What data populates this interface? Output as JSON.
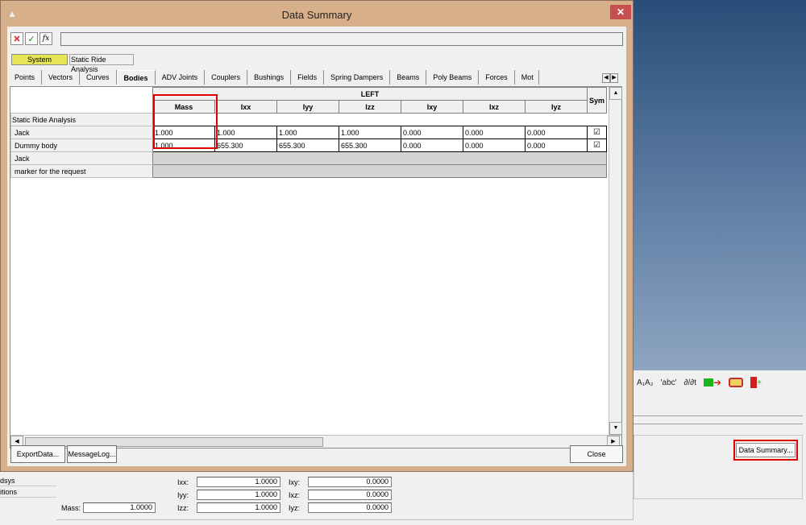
{
  "dialog": {
    "title": "Data Summary",
    "close_glyph": "✕",
    "app_icon": "app-triangle-icon"
  },
  "formula_bar": {
    "cancel_glyph": "✕",
    "accept_glyph": "✓",
    "fx_glyph": "fx",
    "value": ""
  },
  "system": {
    "button_label": "System",
    "current": "Static Ride Analysis"
  },
  "tabs": [
    {
      "label": "Points"
    },
    {
      "label": "Vectors"
    },
    {
      "label": "Curves"
    },
    {
      "label": "Bodies",
      "active": true
    },
    {
      "label": "ADV Joints"
    },
    {
      "label": "Couplers"
    },
    {
      "label": "Bushings"
    },
    {
      "label": "Fields"
    },
    {
      "label": "Spring Dampers"
    },
    {
      "label": "Beams"
    },
    {
      "label": "Poly Beams"
    },
    {
      "label": "Forces"
    },
    {
      "label": "Mot"
    }
  ],
  "grid": {
    "side_header": "LEFT",
    "columns": [
      "Mass",
      "Ixx",
      "Iyy",
      "Izz",
      "Ixy",
      "Ixz",
      "Iyz",
      "Sym"
    ],
    "group": "Static Ride Analysis",
    "rows": [
      {
        "label": "Jack",
        "values": [
          "1.000",
          "1.000",
          "1.000",
          "1.000",
          "0.000",
          "0.000",
          "0.000"
        ],
        "sym": "☑"
      },
      {
        "label": "Dummy body",
        "values": [
          "1.000",
          "655.300",
          "655.300",
          "655.300",
          "0.000",
          "0.000",
          "0.000"
        ],
        "sym": "☑"
      }
    ],
    "extra_rows": [
      "Jack",
      "marker for the request"
    ]
  },
  "buttons": {
    "export": "ExportData...",
    "message_log": "MessageLog...",
    "close": "Close"
  },
  "background": {
    "data_summary_button": "Data Summary...",
    "toolbar_text": "A₁A₂",
    "toolbar_abc": "'abc'",
    "toolbar_deriv": "∂/∂t",
    "list_items": [
      "dsys",
      "itions"
    ],
    "properties": {
      "mass_label": "Mass:",
      "mass_value": "1.0000",
      "ixx_label": "Ixx:",
      "ixx_value": "1.0000",
      "iyy_label": "Iyy:",
      "iyy_value": "1.0000",
      "izz_label": "Izz:",
      "izz_value": "1.0000",
      "ixy_label": "Ixy:",
      "ixy_value": "0.0000",
      "ixz_label": "Ixz:",
      "ixz_value": "0.0000",
      "iyz_label": "Iyz:",
      "iyz_value": "0.0000"
    }
  }
}
